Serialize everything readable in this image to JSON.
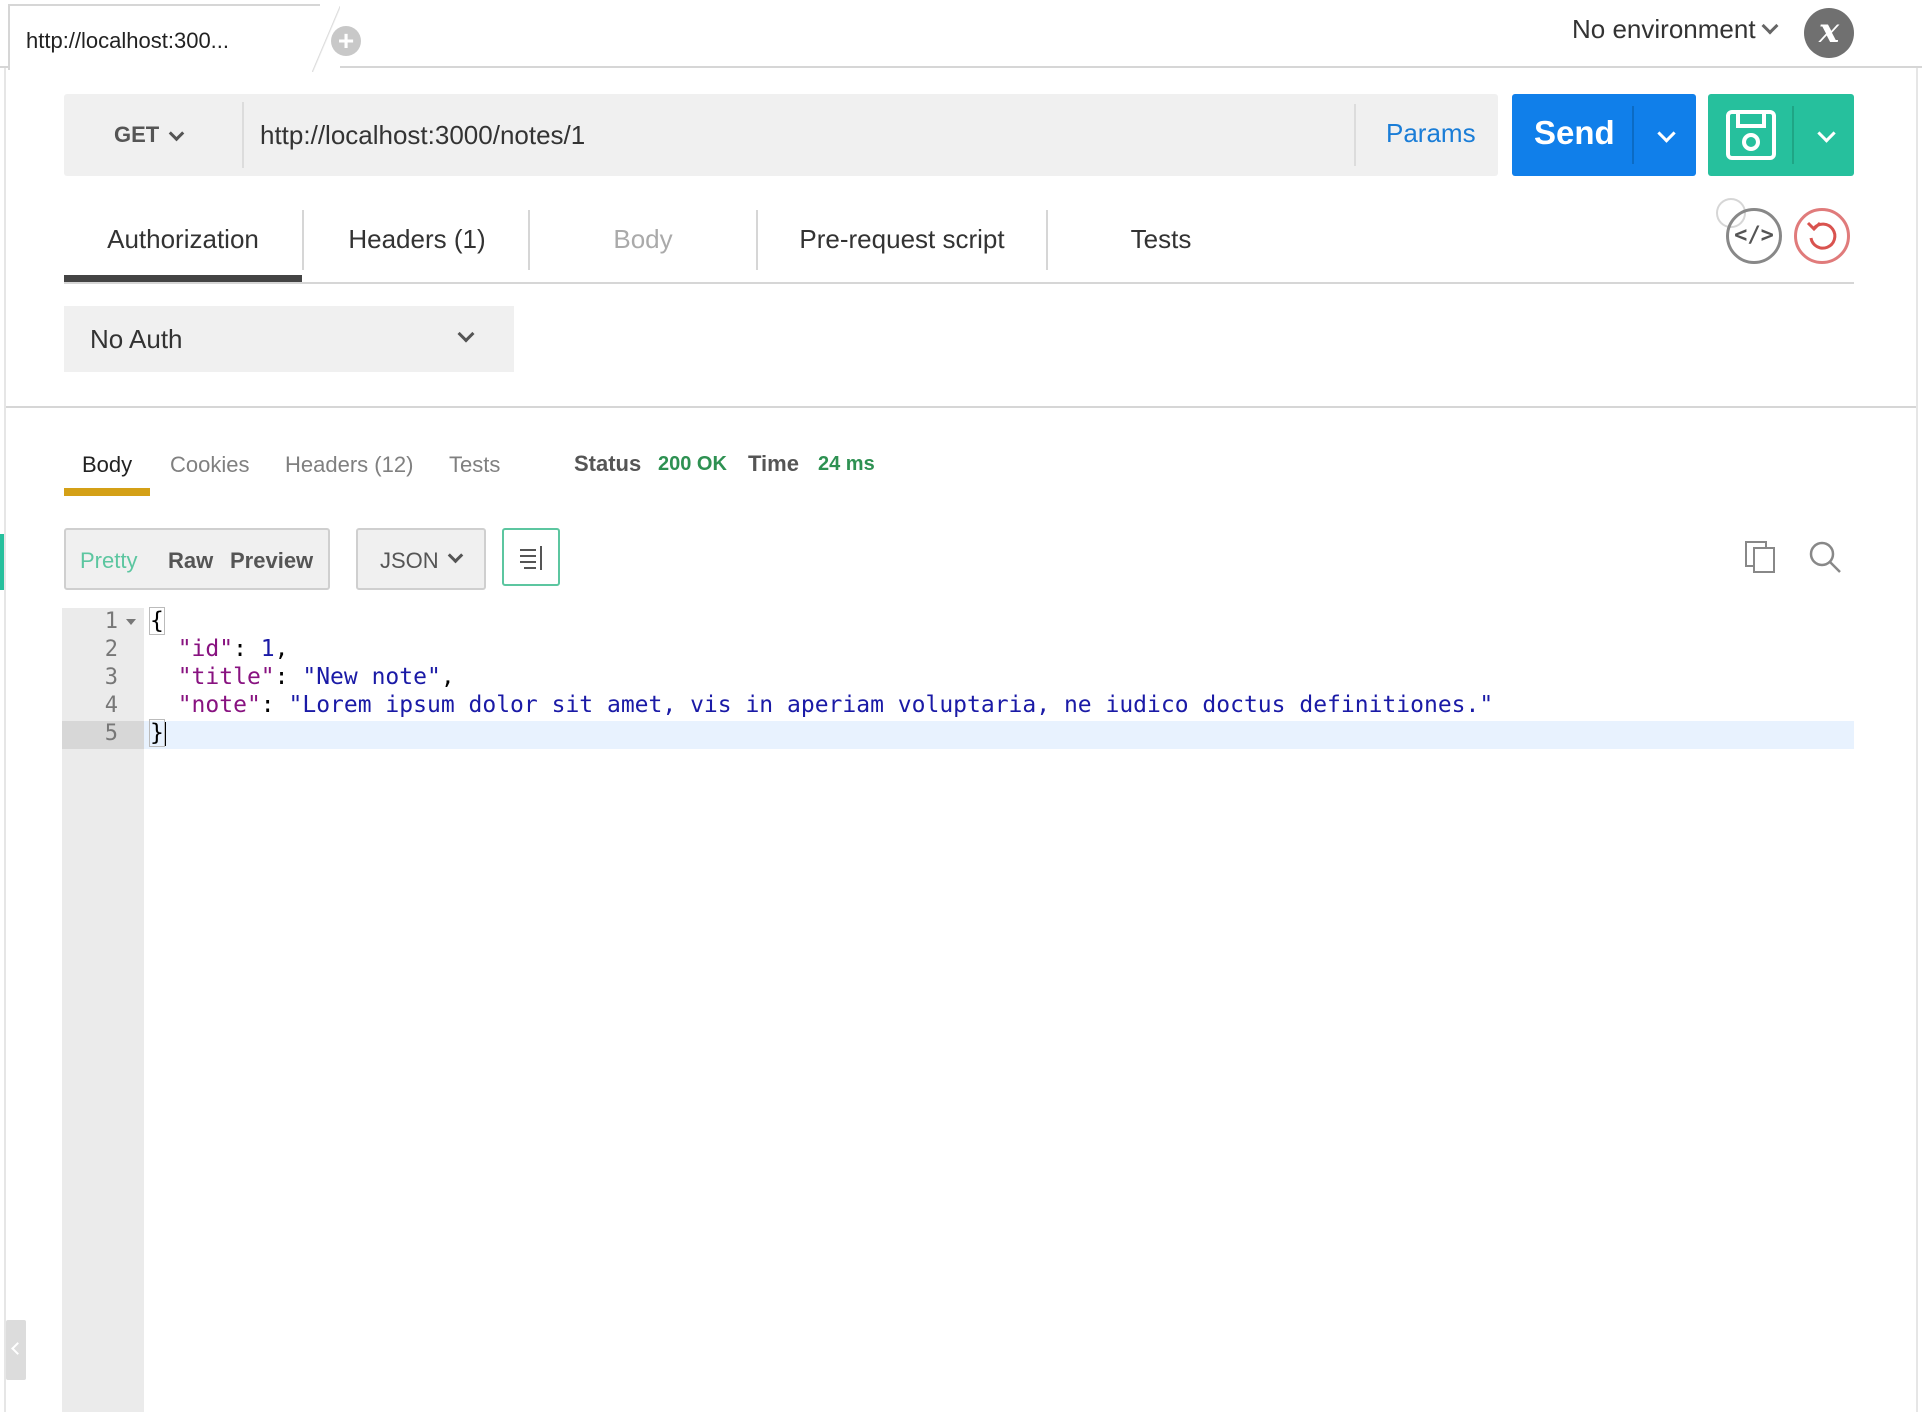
{
  "tabs": {
    "active_title": "http://localhost:300...",
    "add_icon": "plus-circle-icon"
  },
  "environment": {
    "selected": "No environment",
    "logo_letter": "x"
  },
  "request": {
    "method": "GET",
    "url": "http://localhost:3000/notes/1",
    "params_label": "Params",
    "send_label": "Send",
    "save_icon": "save-icon"
  },
  "request_tabs": [
    {
      "label": "Authorization",
      "active": true
    },
    {
      "label": "Headers (1)",
      "active": false
    },
    {
      "label": "Body",
      "active": false,
      "disabled": true
    },
    {
      "label": "Pre-request script",
      "active": false
    },
    {
      "label": "Tests",
      "active": false
    }
  ],
  "auth": {
    "selected": "No Auth"
  },
  "response_tabs": [
    {
      "label": "Body",
      "active": true
    },
    {
      "label": "Cookies",
      "active": false
    },
    {
      "label": "Headers (12)",
      "active": false
    },
    {
      "label": "Tests",
      "active": false
    }
  ],
  "response_meta": {
    "status_label": "Status",
    "status_value": "200 OK",
    "time_label": "Time",
    "time_value": "24 ms"
  },
  "response_format": {
    "modes": [
      "Pretty",
      "Raw",
      "Preview"
    ],
    "active_mode": "Pretty",
    "language": "JSON"
  },
  "colors": {
    "send": "#107fea",
    "save": "#26c09d",
    "status_ok": "#2e9152",
    "active_tab_underline": "#d4a017"
  },
  "code": {
    "line_numbers": [
      "1",
      "2",
      "3",
      "4",
      "5"
    ],
    "open_brace": "{",
    "close_brace": "}",
    "id_key": "\"id\"",
    "id_value": "1",
    "title_key": "\"title\"",
    "title_value": "\"New note\"",
    "note_key": "\"note\"",
    "note_value": "\"Lorem ipsum dolor sit amet, vis in aperiam voluptaria, ne iudico doctus definitiones.\""
  }
}
